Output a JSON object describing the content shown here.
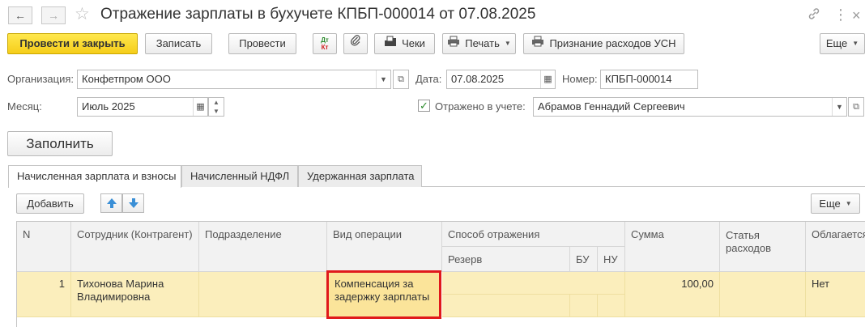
{
  "header": {
    "back_icon": "arrow-left-icon",
    "forward_icon": "arrow-right-icon",
    "title": "Отражение зарплаты в бухучете КПБП-000014 от 07.08.2025"
  },
  "toolbar": {
    "post_close": "Провести и закрыть",
    "save": "Записать",
    "post": "Провести",
    "dtkt_top": "Дт",
    "dtkt_bottom": "Кт",
    "receipts": "Чеки",
    "print": "Печать",
    "expense_recognition": "Признание расходов УСН",
    "more": "Еще"
  },
  "form": {
    "organization_label": "Организация:",
    "organization_value": "Конфетпром ООО",
    "date_label": "Дата:",
    "date_value": "07.08.2025",
    "number_label": "Номер:",
    "number_value": "КПБП-000014",
    "month_label": "Месяц:",
    "month_value": "Июль 2025",
    "reflected_label": "Отражено в учете:",
    "reflected_checked": true,
    "responsible_value": "Абрамов Геннадий Сергеевич",
    "fill_button": "Заполнить"
  },
  "tabs": [
    {
      "label": "Начисленная зарплата и взносы",
      "active": true
    },
    {
      "label": "Начисленный НДФЛ",
      "active": false
    },
    {
      "label": "Удержанная зарплата",
      "active": false
    }
  ],
  "table_toolbar": {
    "add": "Добавить",
    "more": "Еще"
  },
  "table": {
    "headers": {
      "n": "N",
      "employee": "Сотрудник (Контрагент)",
      "department": "Подразделение",
      "operation": "Вид операции",
      "method": "Способ отражения",
      "reserve": "Резерв",
      "bu": "БУ",
      "nu": "НУ",
      "sum": "Сумма",
      "expense_item": "Статья расходов",
      "taxable": "Облагается"
    },
    "rows": [
      {
        "n": "1",
        "employee": "Тихонова Марина Владимировна",
        "department": "",
        "operation": "Компенсация за задержку зарплаты",
        "sum": "100,00",
        "expense_item": "",
        "taxable": "Нет"
      }
    ]
  },
  "colors": {
    "primary_button": "#f5cd1a",
    "selected_row": "#fbeebc",
    "highlight_border": "#e0191b"
  }
}
